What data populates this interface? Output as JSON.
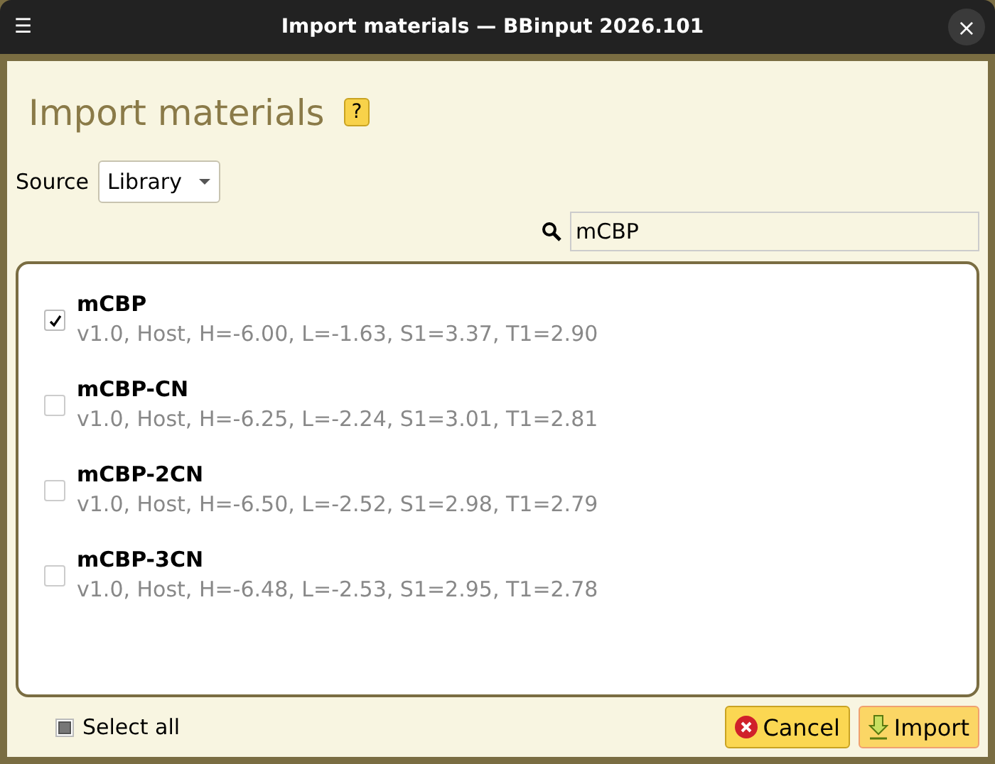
{
  "window": {
    "title": "Import materials — BBinput 2026.101",
    "menu_icon": "☰",
    "close_icon": "×"
  },
  "heading": {
    "title": "Import materials",
    "help": "?"
  },
  "source": {
    "label": "Source",
    "value": "Library"
  },
  "search": {
    "value": "mCBP"
  },
  "materials": [
    {
      "name": "mCBP",
      "details": "v1.0, Host, H=-6.00, L=-1.63, S1=3.37, T1=2.90",
      "checked": true
    },
    {
      "name": "mCBP-CN",
      "details": "v1.0, Host, H=-6.25, L=-2.24, S1=3.01, T1=2.81",
      "checked": false
    },
    {
      "name": "mCBP-2CN",
      "details": "v1.0, Host, H=-6.50, L=-2.52, S1=2.98, T1=2.79",
      "checked": false
    },
    {
      "name": "mCBP-3CN",
      "details": "v1.0, Host, H=-6.48, L=-2.53, S1=2.95, T1=2.78",
      "checked": false
    }
  ],
  "select_all": {
    "label": "Select all",
    "indeterminate": true
  },
  "buttons": [
    {
      "label": "Cancel",
      "kind": "cancel"
    },
    {
      "label": "Import",
      "kind": "import"
    }
  ]
}
